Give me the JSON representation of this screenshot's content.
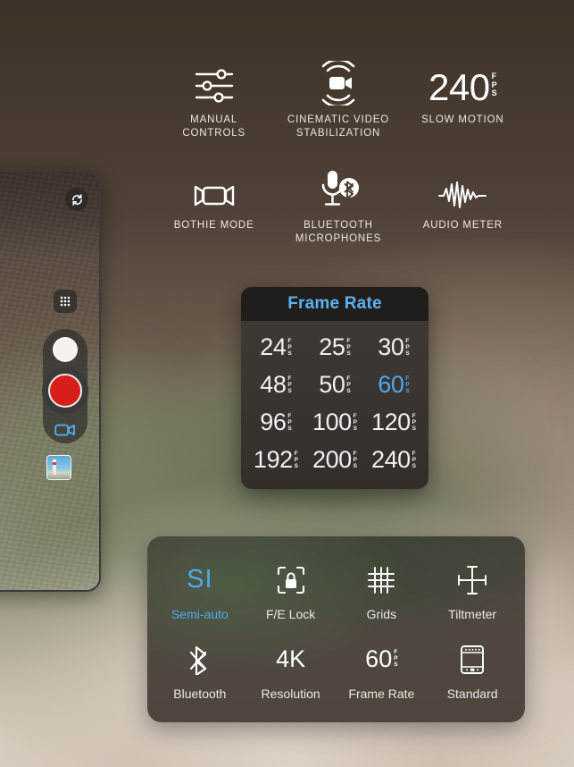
{
  "features": [
    {
      "id": "manual-controls",
      "icon": "sliders-icon",
      "label": "MANUAL\nCONTROLS"
    },
    {
      "id": "cinematic-video-stabilization",
      "icon": "stabilized-camcorder-icon",
      "label": "CINEMATIC VIDEO\nSTABILIZATION"
    },
    {
      "id": "slow-motion",
      "icon": "fps-number",
      "value": "240",
      "unit": "FPS",
      "label": "SLOW MOTION"
    },
    {
      "id": "bothie-mode",
      "icon": "dual-camcorder-icon",
      "label": "BOTHIE MODE"
    },
    {
      "id": "bluetooth-microphones",
      "icon": "microphone-bluetooth-icon",
      "label": "BLUETOOTH\nMICROPHONES"
    },
    {
      "id": "audio-meter",
      "icon": "waveform-icon",
      "label": "AUDIO METER"
    }
  ],
  "viewfinder": {
    "flip_camera_icon": "flip-camera-icon",
    "grid_icon": "grid-dots-icon",
    "photo_shutter_icon": "photo-shutter-icon",
    "record_icon": "record-button-icon",
    "mode_icon": "video-mode-icon",
    "thumbnail_icon": "last-photo-thumbnail"
  },
  "frame_rate_popover": {
    "title": "Frame Rate",
    "unit": "FPS",
    "selected": "60",
    "options": [
      "24",
      "25",
      "30",
      "48",
      "50",
      "60",
      "96",
      "100",
      "120",
      "192",
      "200",
      "240"
    ]
  },
  "settings_panel": {
    "items": [
      {
        "id": "semi-auto",
        "icon": "si-text-icon",
        "value": "SI",
        "label": "Semi-auto",
        "active": true
      },
      {
        "id": "fe-lock",
        "icon": "lock-focus-icon",
        "value": "",
        "label": "F/E Lock",
        "active": false
      },
      {
        "id": "grids",
        "icon": "grid-lines-icon",
        "value": "",
        "label": "Grids",
        "active": false
      },
      {
        "id": "tiltmeter",
        "icon": "crosshair-level-icon",
        "value": "",
        "label": "Tiltmeter",
        "active": false
      },
      {
        "id": "bluetooth",
        "icon": "bluetooth-icon",
        "value": "",
        "label": "Bluetooth",
        "active": false
      },
      {
        "id": "resolution",
        "icon": "resolution-text-icon",
        "value": "4K",
        "label": "Resolution",
        "active": false
      },
      {
        "id": "frame-rate",
        "icon": "fps-number",
        "value": "60",
        "unit": "FPS",
        "label": "Frame Rate",
        "active": false
      },
      {
        "id": "standard",
        "icon": "film-frame-icon",
        "value": "",
        "label": "Standard",
        "active": false
      }
    ]
  },
  "colors": {
    "accent_blue": "#4fa9f0",
    "title_blue": "#5cb2f2",
    "record_red": "#d61f18",
    "panel_dark": "#201d1b",
    "text_light": "#ece8e4"
  }
}
